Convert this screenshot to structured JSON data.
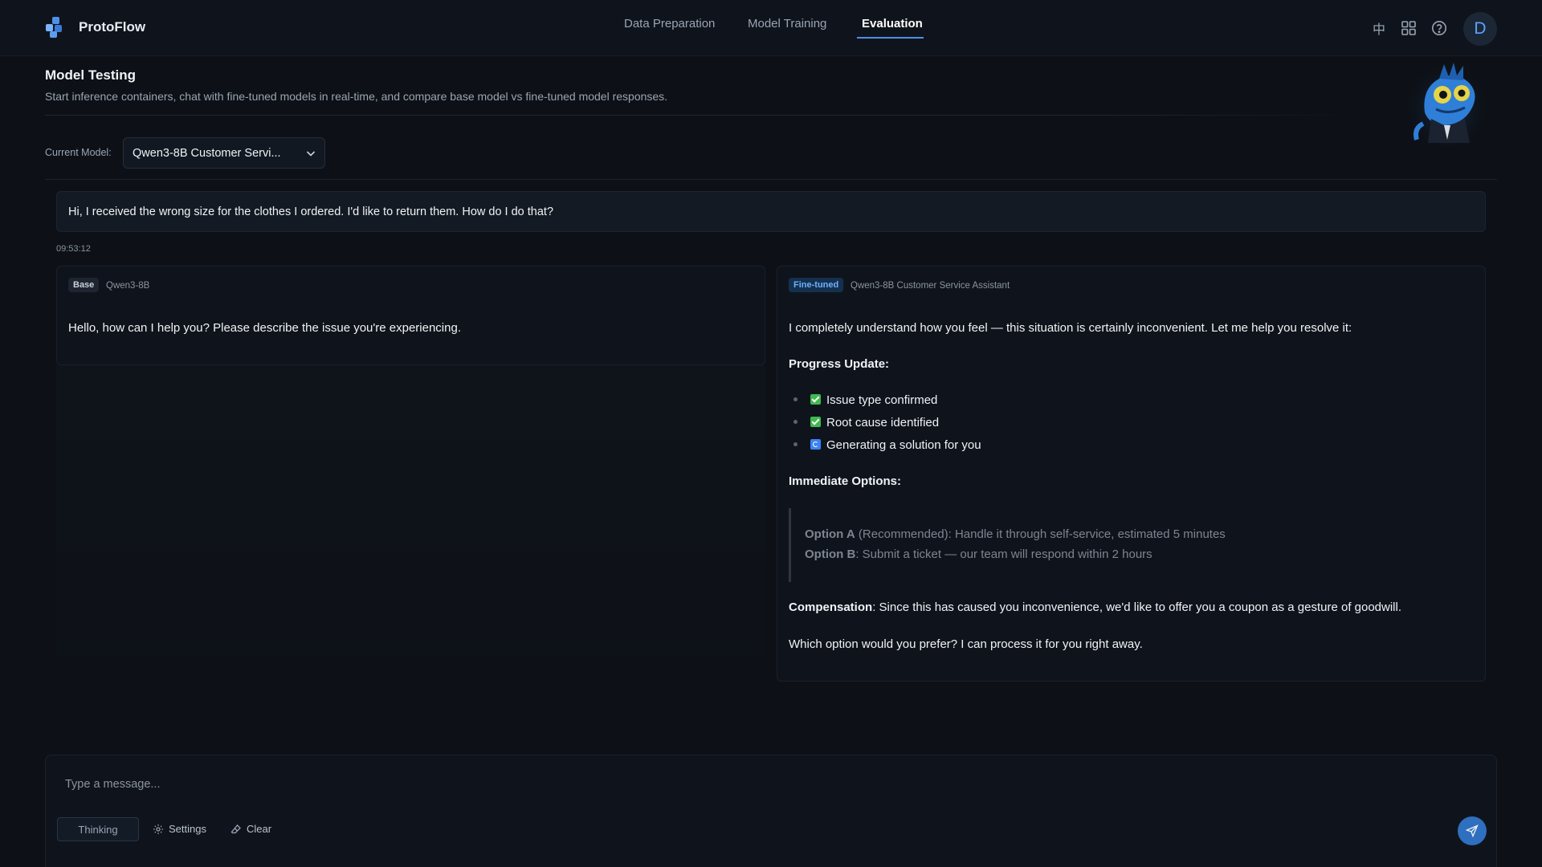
{
  "app": {
    "name": "ProtoFlow"
  },
  "nav": {
    "tabs": [
      {
        "label": "Data Preparation"
      },
      {
        "label": "Model Training"
      },
      {
        "label": "Evaluation"
      }
    ],
    "active_tab": "Evaluation",
    "icons": [
      "language-icon",
      "apps-grid-icon",
      "help-icon"
    ],
    "language_glyph": "中",
    "avatar_initial": "D"
  },
  "page": {
    "title": "Model Testing",
    "subtitle": "Start inference containers, chat with fine-tuned models in real-time, and compare base model vs fine-tuned model responses."
  },
  "model_selector": {
    "label": "Current Model:",
    "value": "Qwen3-8B Customer Servi..."
  },
  "chat": {
    "user_message": "Hi, I received the wrong size for the clothes I ordered. I'd like to return them. How do I do that?",
    "timestamp": "09:53:12",
    "base": {
      "badge": "Base",
      "model": "Qwen3-8B",
      "text": "Hello, how can I help you? Please describe the issue you're experiencing."
    },
    "finetuned": {
      "badge": "Fine-tuned",
      "model": "Qwen3-8B Customer Service Assistant",
      "intro": "I completely understand how you feel — this situation is certainly inconvenient. Let me help you resolve it:",
      "progress_heading": "Progress Update:",
      "progress_items": [
        {
          "status": "done",
          "text": "Issue type confirmed"
        },
        {
          "status": "done",
          "text": "Root cause identified"
        },
        {
          "status": "in-progress",
          "text": "Generating a solution for you"
        }
      ],
      "options_heading": "Immediate Options:",
      "options": [
        {
          "label": "Option A",
          "text": " (Recommended): Handle it through self-service, estimated 5 minutes"
        },
        {
          "label": "Option B",
          "text": ": Submit a ticket — our team will respond within 2 hours"
        }
      ],
      "compensation_label": "Compensation",
      "compensation_text": ": Since this has caused you inconvenience, we'd like to offer you a coupon as a gesture of goodwill.",
      "closing": "Which option would you prefer? I can process it for you right away."
    }
  },
  "composer": {
    "placeholder": "Type a message...",
    "thinking_label": "Thinking",
    "settings_label": "Settings",
    "clear_label": "Clear"
  },
  "colors": {
    "background": "#0d1117",
    "accent": "#4f8fe8",
    "finetuned_badge": "#15304f",
    "check_done": "#3fb950",
    "check_in_progress": "#3b82f6"
  }
}
